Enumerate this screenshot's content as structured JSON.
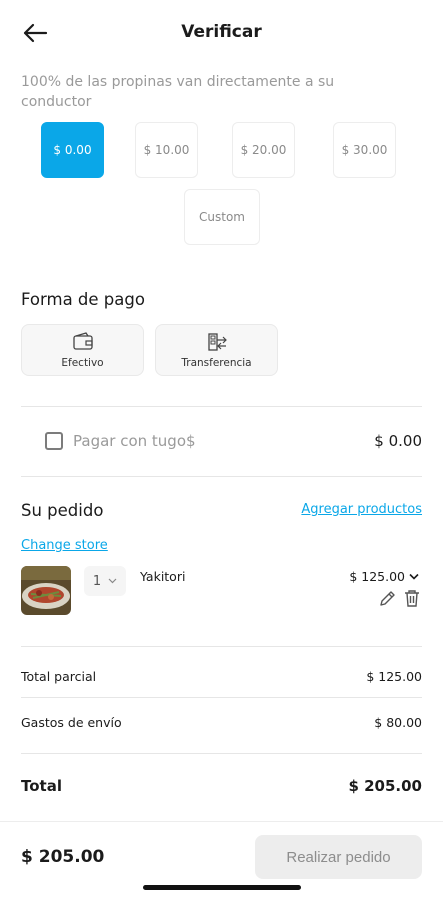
{
  "header": {
    "title": "Verificar",
    "back_icon": "arrow-left-icon"
  },
  "tips": {
    "note": "100% de las propinas van directamente a su conductor",
    "options": [
      "$ 0.00",
      "$ 10.00",
      "$ 20.00",
      "$ 30.00"
    ],
    "custom_label": "Custom",
    "selected": "$ 0.00"
  },
  "payment": {
    "title": "Forma de pago",
    "methods": [
      {
        "label": "Efectivo",
        "icon": "wallet-icon"
      },
      {
        "label": "Transferencia",
        "icon": "bank-transfer-icon"
      }
    ]
  },
  "tugo": {
    "label": "Pagar con tugo$",
    "amount": "$ 0.00",
    "checked": false
  },
  "order": {
    "title": "Su pedido",
    "add_products": "Agregar productos",
    "change_store": "Change store",
    "items": [
      {
        "name": "Yakitori",
        "quantity": "1",
        "price": "$ 125.00"
      }
    ]
  },
  "summary": {
    "subtotal_label": "Total parcial",
    "subtotal_value": "$ 125.00",
    "shipping_label": "Gastos de envío",
    "shipping_value": "$ 80.00",
    "total_label": "Total",
    "total_value": "$ 205.00"
  },
  "footer": {
    "total": "$ 205.00",
    "place_order": "Realizar pedido"
  },
  "colors": {
    "accent": "#0aa7e8",
    "button_disabled_bg": "#ededed",
    "muted_text": "#9a9a9a"
  }
}
